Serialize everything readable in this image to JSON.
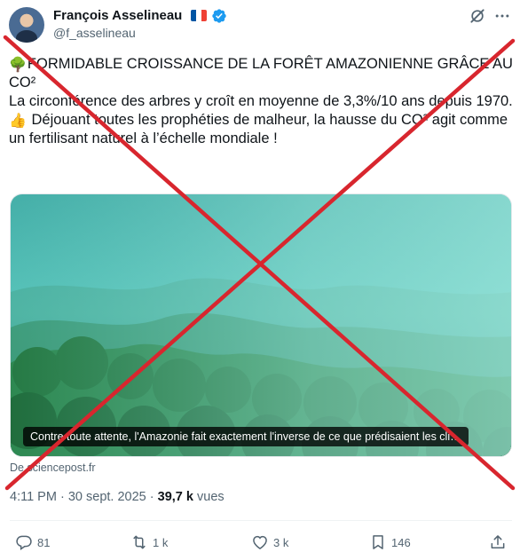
{
  "author": {
    "name": "François Asselineau",
    "handle": "@f_asselineau",
    "flag_colors": [
      "#0055a4",
      "#ffffff",
      "#ef4135"
    ],
    "verified_color": "#1d9bf0"
  },
  "header_icons": [
    "grok-icon",
    "more-icon"
  ],
  "tweet": {
    "line1_emoji": "🌳",
    "line1": "FORMIDABLE CROISSANCE DE LA FORÊT AMAZONIENNE GRÂCE AU CO²",
    "line2": "La circonférence des arbres y croît en moyenne de 3,3%/10 ans depuis 1970.",
    "line3_emoji": "👍",
    "line3": "Déjouant toutes les prophéties de malheur, la hausse du CO² agit comme un fertilisant naturel à l’échelle mondiale !"
  },
  "media": {
    "caption": "Contre toute attente, l'Amazonie fait exactement l'inverse de ce que prédisaient les cli…",
    "source": "De sciencepost.fr"
  },
  "meta": {
    "time": "4:11 PM",
    "separator": "·",
    "date": "30 sept. 2025",
    "views_count": "39,7 k",
    "views_label": "vues"
  },
  "actions": {
    "replies": "81",
    "reposts": "1 k",
    "likes": "3 k",
    "bookmarks": "146"
  },
  "overlay": {
    "cross_color": "#d8262e"
  }
}
